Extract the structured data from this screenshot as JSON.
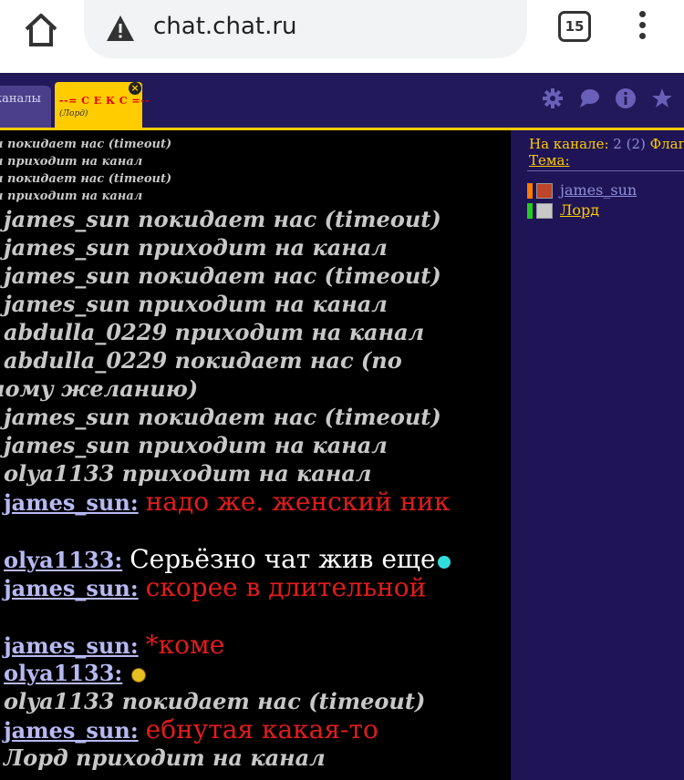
{
  "browser": {
    "url": "chat.chat.ru",
    "tab_count": "15"
  },
  "topbar": {
    "tab_channels": "каналы",
    "active_tab_title": "--= С Е К С =--",
    "active_tab_sub": "(Лорд)",
    "close_glyph": "×"
  },
  "messages": {
    "sys_small": [
      "н покидает нас (timeout)",
      "н приходит на канал",
      "н покидает нас (timeout)",
      "н приходит на канал"
    ],
    "sys_1": "james_sun покидает нас (timeout)",
    "sys_2": "james_sun приходит на канал",
    "sys_3": "james_sun покидает нас (timeout)",
    "sys_4": "james_sun приходит на канал",
    "sys_5": "abdulla_0229 приходит на канал",
    "sys_6": "abdulla_0229 покидает нас (по",
    "sys_6b": "ному желанию)",
    "sys_7": "james_sun покидает нас (timeout)",
    "sys_8": "james_sun приходит на канал",
    "sys_9": "olya1133 приходит на канал",
    "chat_1_nick": "james_sun:",
    "chat_1_text": "надо же. женский ник",
    "chat_2_nick": "olya1133:",
    "chat_2_text": "Серьёзно чат жив еще",
    "chat_3_nick": "james_sun:",
    "chat_3_text": "скорее в длительной",
    "chat_4_nick": "james_sun:",
    "chat_4_text": "*коме",
    "chat_5_nick": "olya1133:",
    "sys_10": "olya1133 покидает нас (timeout)",
    "chat_6_nick": "james_sun:",
    "chat_6_text": "ебнутая какая-то",
    "sys_11": "Лорд приходит на канал"
  },
  "sidebar": {
    "on_channel_label": "На канале:",
    "count": "2 (2)",
    "flag_label": "Флаг",
    "topic_label": "Тема:",
    "users": [
      {
        "name": "james_sun",
        "color": "#8f8fd8",
        "stripe": "#ff7a00"
      },
      {
        "name": "Лорд",
        "color": "#ffcc00",
        "stripe": "#22cc22"
      }
    ]
  },
  "colors": {
    "accent": "#ffcc00",
    "chat_bg": "#000000",
    "panel_bg": "#1e1456",
    "red_text": "#e21c1c",
    "nick": "#b7b9f3"
  }
}
